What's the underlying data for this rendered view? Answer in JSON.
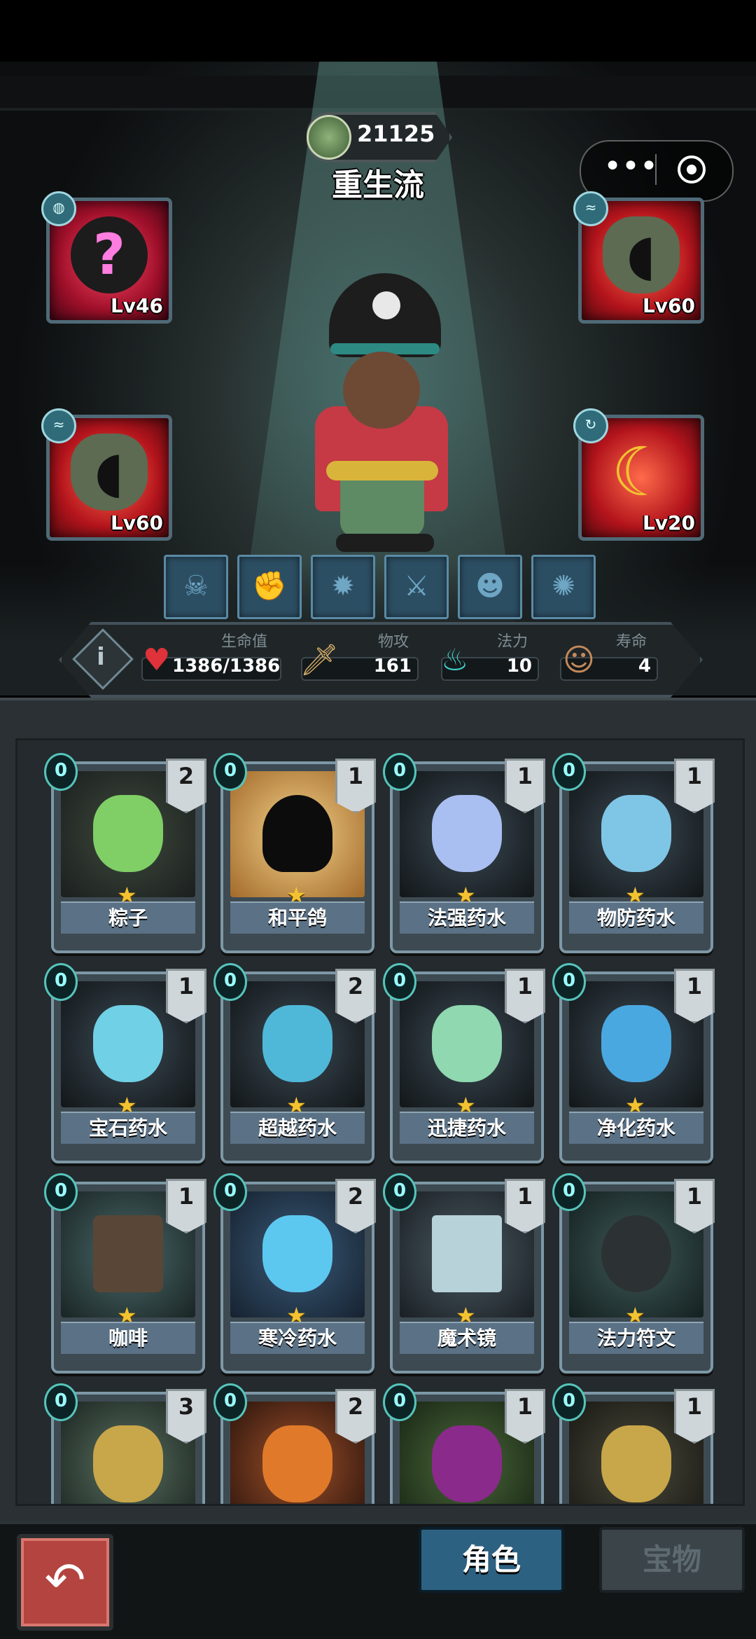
{
  "header": {
    "gold": "21125",
    "deck_name": "重生流",
    "mini_program": {
      "more_icon": "more-dots-icon",
      "close_icon": "target-circle-icon"
    }
  },
  "equipment": [
    {
      "level": "Lv46",
      "icon": "mystery-orb-icon"
    },
    {
      "level": "Lv60",
      "icon": "monster-mouth-icon"
    },
    {
      "level": "Lv60",
      "icon": "monster-mouth-icon"
    },
    {
      "level": "Lv20",
      "icon": "moon-amulet-icon"
    }
  ],
  "skills": [
    "bird-skull-icon",
    "wrench-arm-icon",
    "gear-bomb-icon",
    "crossed-sword-icon",
    "demon-mask-icon",
    "flame-wolf-icon"
  ],
  "stats": {
    "hp_label": "生命值",
    "hp_value": "1386/1386",
    "atk_label": "物攻",
    "atk_value": "161",
    "mana_label": "法力",
    "mana_value": "10",
    "life_label": "寿命",
    "life_value": "4"
  },
  "cards": [
    {
      "name": "粽子",
      "cost": "0",
      "count": "2"
    },
    {
      "name": "和平鸽",
      "cost": "0",
      "count": "1"
    },
    {
      "name": "法强药水",
      "cost": "0",
      "count": "1"
    },
    {
      "name": "物防药水",
      "cost": "0",
      "count": "1"
    },
    {
      "name": "宝石药水",
      "cost": "0",
      "count": "1"
    },
    {
      "name": "超越药水",
      "cost": "0",
      "count": "2"
    },
    {
      "name": "迅捷药水",
      "cost": "0",
      "count": "1"
    },
    {
      "name": "净化药水",
      "cost": "0",
      "count": "1"
    },
    {
      "name": "咖啡",
      "cost": "0",
      "count": "1"
    },
    {
      "name": "寒冷药水",
      "cost": "0",
      "count": "2"
    },
    {
      "name": "魔术镜",
      "cost": "0",
      "count": "1"
    },
    {
      "name": "法力符文",
      "cost": "0",
      "count": "1"
    },
    {
      "name": "",
      "cost": "0",
      "count": "3"
    },
    {
      "name": "",
      "cost": "0",
      "count": "2"
    },
    {
      "name": "",
      "cost": "0",
      "count": "1"
    },
    {
      "name": "",
      "cost": "0",
      "count": "1"
    }
  ],
  "nav": {
    "back_icon": "return-arrow-icon",
    "tab_role": "角色",
    "tab_treasure": "宝物"
  },
  "colors": {
    "card_border": "#7d98a6",
    "name_bar": "#5b7185",
    "star": "#f2c230",
    "tab_active": "#2d6181"
  }
}
